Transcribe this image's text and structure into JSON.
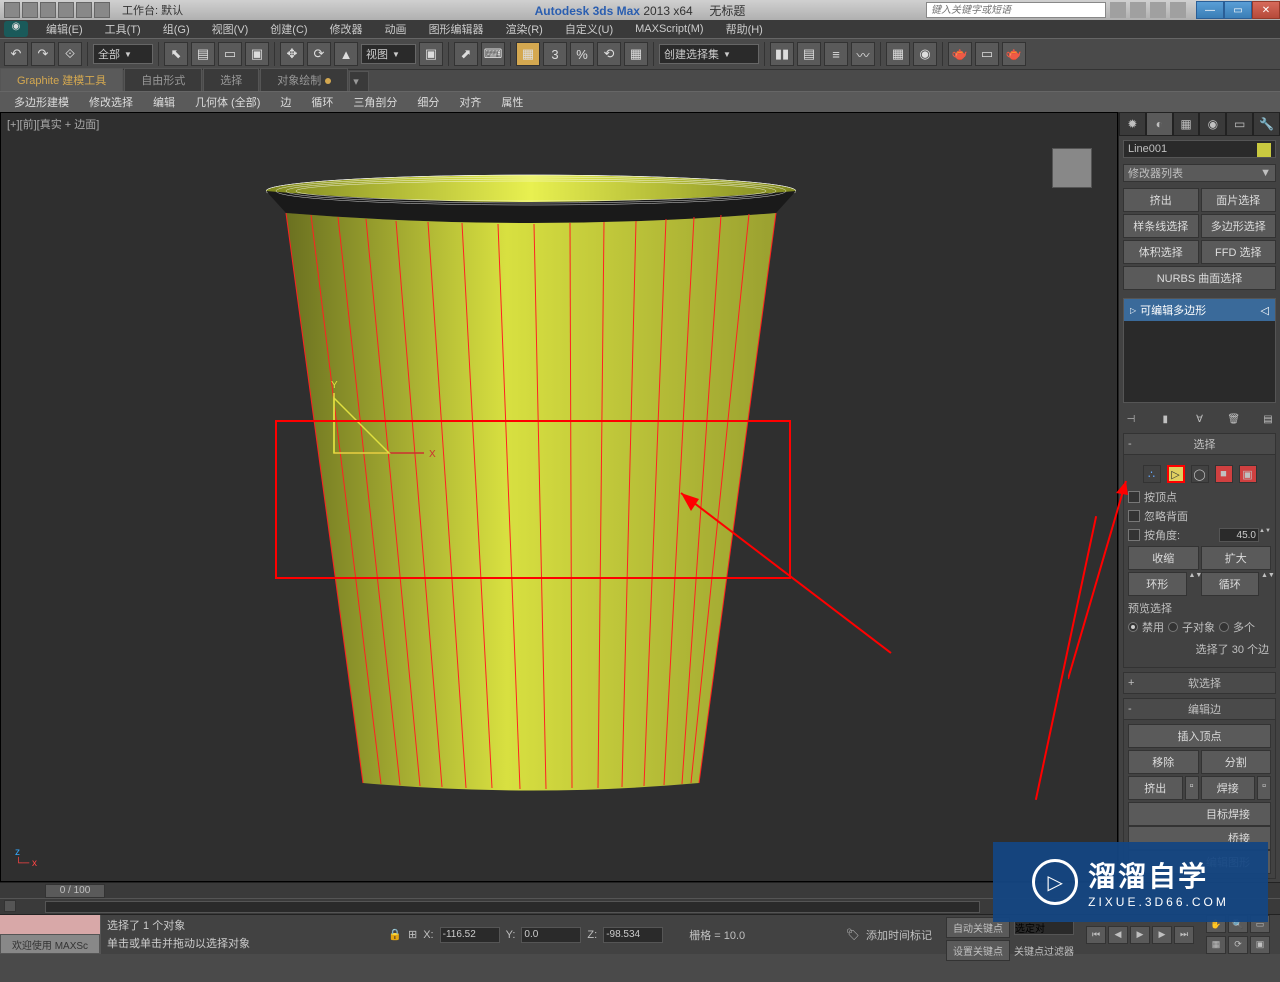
{
  "title_bar": {
    "workspace_label": "工作台: 默认",
    "app_name": "Autodesk 3ds Max",
    "app_version": "2013 x64",
    "doc_name": "无标题",
    "search_placeholder": "键入关键字或短语"
  },
  "menu": {
    "items": [
      "编辑(E)",
      "工具(T)",
      "组(G)",
      "视图(V)",
      "创建(C)",
      "修改器",
      "动画",
      "图形编辑器",
      "渲染(R)",
      "自定义(U)",
      "MAXScript(M)",
      "帮助(H)"
    ]
  },
  "toolbar": {
    "selection_filter": "全部",
    "view_dropdown": "视图",
    "named_sel_set": "创建选择集",
    "snap_angle": "3"
  },
  "ribbon": {
    "tabs": [
      "Graphite 建模工具",
      "自由形式",
      "选择",
      "对象绘制"
    ],
    "active_tab": 0,
    "items": [
      "多边形建模",
      "修改选择",
      "编辑",
      "几何体 (全部)",
      "边",
      "循环",
      "三角剖分",
      "细分",
      "对齐",
      "属性"
    ]
  },
  "viewport": {
    "label": "[+][前][真实 + 边面]",
    "axis_y": "Y",
    "axis_x": "X"
  },
  "command_panel": {
    "object_name": "Line001",
    "modifier_list_label": "修改器列表",
    "buttons": {
      "extrude": "挤出",
      "face_sel": "面片选择",
      "spline_sel": "样条线选择",
      "poly_sel": "多边形选择",
      "vol_sel": "体积选择",
      "ffd_sel": "FFD 选择",
      "nurbs_sel": "NURBS 曲面选择"
    },
    "stack_item": "可编辑多边形",
    "selection_rollout": {
      "title": "选择",
      "by_vertex": "按顶点",
      "ignore_backfacing": "忽略背面",
      "by_angle": "按角度:",
      "angle_value": "45.0",
      "shrink": "收缩",
      "grow": "扩大",
      "ring": "环形",
      "loop": "循环",
      "preview_label": "预览选择",
      "preview_off": "禁用",
      "preview_subobj": "子对象",
      "preview_multi": "多个",
      "selected_info": "选择了 30 个边"
    },
    "soft_sel_title": "软选择",
    "edit_edges": {
      "title": "编辑边",
      "insert_vertex": "插入顶点",
      "remove": "移除",
      "split": "分割",
      "extrude": "挤出",
      "weld": "焊接",
      "target_weld": "目标焊接",
      "bridge": "桥接",
      "edit_tri": "编辑图形"
    }
  },
  "timeline": {
    "slider": "0 / 100"
  },
  "status": {
    "welcome": "欢迎使用 MAXSc",
    "prompt1": "选择了 1 个对象",
    "prompt2": "单击或单击并拖动以选择对象",
    "x_label": "X:",
    "x_value": "-116.52",
    "y_label": "Y:",
    "y_value": "0.0",
    "z_label": "Z:",
    "z_value": "-98.534",
    "grid_label": "栅格 = 10.0",
    "auto_key": "自动关键点",
    "set_key": "设置关键点",
    "sel_set_label": "选定对",
    "key_filter": "关键点过滤器",
    "add_time_tag": "添加时间标记"
  },
  "watermark": {
    "big": "溜溜自学",
    "small": "ZIXUE.3D66.COM"
  }
}
